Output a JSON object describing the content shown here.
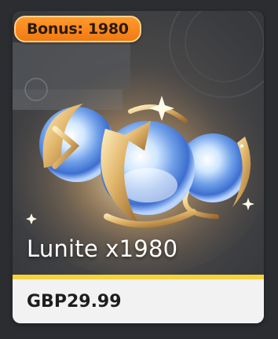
{
  "card": {
    "bonus_label": "Bonus: 1980",
    "product_name": "Lunite x1980",
    "price": "GBP29.99",
    "image_icon": "lunite-orbs-icon"
  },
  "colors": {
    "badge": "#f07a12",
    "accent": "#f5d33a",
    "price_bg": "#f2f2f2",
    "page_bg": "#2b2d31"
  }
}
